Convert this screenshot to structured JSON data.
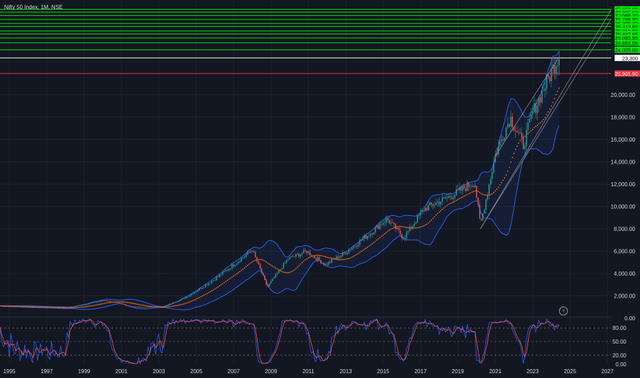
{
  "header": {
    "symbol_title": "Nifty 50 Index, 1M, NSE"
  },
  "icons": {
    "alert": "lightning-bolt-icon"
  },
  "colors": {
    "background": "#131722",
    "up": "#26a69a",
    "down": "#ef5350",
    "bollinger": "#2962ff",
    "green_levels": "#00e600",
    "red_level": "#f23645",
    "white_level": "#ffffff",
    "stoch_k": "#2962ff",
    "stoch_d": "#ff5252"
  },
  "chart_data": {
    "type": "candlestick",
    "title": "Nifty 50 Index, 1M, NSE",
    "price_axis": {
      "ylim": [
        0,
        28300
      ],
      "ticks": [
        0,
        2000,
        4000,
        6000,
        8000,
        10000,
        12000,
        14000,
        16000,
        18000,
        20000
      ],
      "tick_labels": [
        "0.00",
        "2,000.00",
        "4,000.00",
        "6,000.00",
        "8,000.00",
        "10,000.00",
        "12,000.00",
        "14,000.00",
        "16,000.00",
        "18,000.00",
        "20,000.00"
      ]
    },
    "time_axis": {
      "xlim": [
        1994.5,
        2027.2
      ],
      "ticks": [
        1995,
        1997,
        1999,
        2001,
        2003,
        2005,
        2007,
        2009,
        2011,
        2013,
        2015,
        2017,
        2019,
        2021,
        2023,
        2025,
        2027
      ],
      "tick_labels": [
        "1995",
        "1997",
        "1999",
        "2001",
        "2003",
        "2005",
        "2007",
        "2009",
        "2011",
        "2013",
        "2015",
        "2017",
        "2019",
        "2021",
        "2023",
        "2025",
        "2027"
      ]
    },
    "price_path_keypoints": {
      "years": [
        1994.5,
        1996,
        1998,
        1999.5,
        2000.1,
        2001.7,
        2003.2,
        2004.5,
        2006,
        2008.0,
        2008.8,
        2009.9,
        2010.9,
        2011.9,
        2013,
        2014.3,
        2015.2,
        2016.1,
        2017.2,
        2018.7,
        2019.9,
        2020.2,
        2021.0,
        2021.8,
        2022.5,
        2023.0,
        2023.9,
        2024.4
      ],
      "prices": [
        1100,
        1000,
        900,
        1400,
        1600,
        1000,
        1000,
        1900,
        3500,
        6100,
        2800,
        5300,
        6000,
        4800,
        5900,
        7600,
        8900,
        7200,
        9800,
        11000,
        12200,
        8300,
        14600,
        18000,
        15500,
        18400,
        21700,
        23500
      ]
    },
    "horizontal_levels": {
      "green_labels": [
        "27,653.00",
        "27,391.60",
        "27,096.20",
        "26,746.95",
        "26,386.20",
        "26,113.80",
        "25,716.65",
        "25,442.65",
        "25,085.95",
        "24,653.05",
        "24,025.00"
      ],
      "green_values": [
        27653,
        27391.6,
        27096.2,
        26746.95,
        26386.2,
        26113.8,
        25716.65,
        25442.65,
        25085.95,
        24653.05,
        24025
      ],
      "white_value": 23300,
      "white_label": "23,300",
      "red_value": 21901.9,
      "red_label": "21,901.90"
    },
    "stochastic": {
      "ylim": [
        0,
        100
      ],
      "ticks": [
        0,
        20,
        50,
        80
      ],
      "tick_labels": [
        "0.00",
        "20.00",
        "50.00",
        "80.00"
      ]
    }
  }
}
